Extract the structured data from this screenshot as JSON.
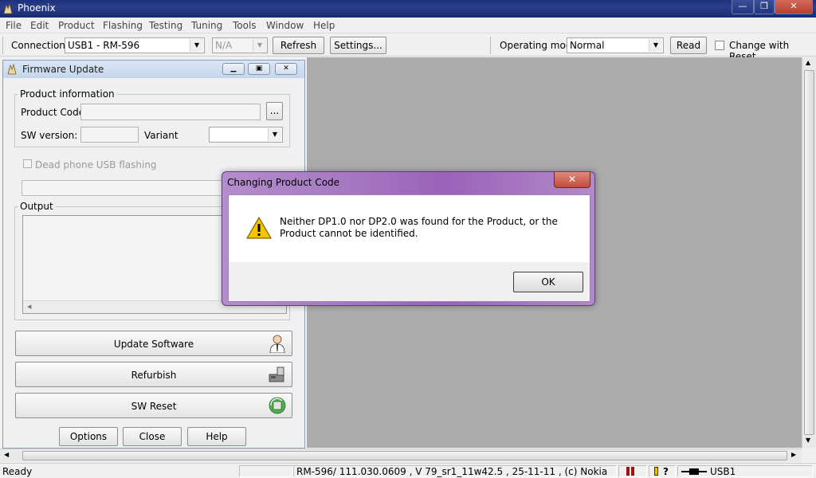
{
  "window": {
    "title": "Phoenix",
    "min": "—",
    "max": "❐",
    "close": "✕"
  },
  "menu": [
    "File",
    "Edit",
    "Product",
    "Flashing",
    "Testing",
    "Tuning",
    "Tools",
    "Window",
    "Help"
  ],
  "toolbar": {
    "connections_label": "Connections:",
    "connection_value": "USB1 - RM-596",
    "na_value": "N/A",
    "refresh": "Refresh",
    "settings": "Settings...",
    "operating_mode_label": "Operating mode:",
    "operating_mode_value": "Normal",
    "read": "Read",
    "change_with_reset": "Change with Reset"
  },
  "firmware": {
    "title": "Firmware Update",
    "product_info_legend": "Product information",
    "product_code_label": "Product Code:",
    "browse": "...",
    "sw_version_label": "SW version:",
    "variant_label": "Variant",
    "dead_phone": "Dead phone USB flashing",
    "output_legend": "Output",
    "update_software": "Update Software",
    "refurbish": "Refurbish",
    "sw_reset": "SW Reset",
    "options": "Options",
    "close": "Close",
    "help": "Help"
  },
  "dialog": {
    "title": "Changing Product Code",
    "message": "Neither DP1.0 nor DP2.0 was found for the Product, or the Product cannot be identified.",
    "ok": "OK"
  },
  "status": {
    "ready": "Ready",
    "info": "RM-596/ 111.030.0609 , V 79_sr1_11w42.5 , 25-11-11 , (c) Nokia",
    "help_glyph": "?",
    "connection": "USB1"
  }
}
